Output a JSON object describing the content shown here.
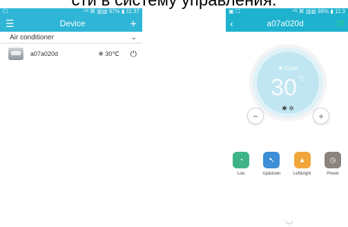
{
  "caption": "сти в систему управления.",
  "left": {
    "status": {
      "left_icon": "☐",
      "right": "⁴ᴳ ⌘ ▥▥ 97% ▮ 11:37"
    },
    "title": "Device",
    "section": "Air conditioner",
    "device": {
      "name": "a07a020d",
      "temp": "❄ 30℃"
    }
  },
  "right": {
    "status": {
      "left_icons": "▣ ☐",
      "right": "⁴ᴳ ⌘ ▥▥ 98% ▮ 11:3"
    },
    "title": "a07a020d",
    "mode": "❄ Cool",
    "temperature": "30",
    "unit": "°C",
    "fan_speed": "✱ ✲",
    "buttons": [
      "Low",
      "Up&down",
      "Left&right",
      "Preset"
    ]
  }
}
